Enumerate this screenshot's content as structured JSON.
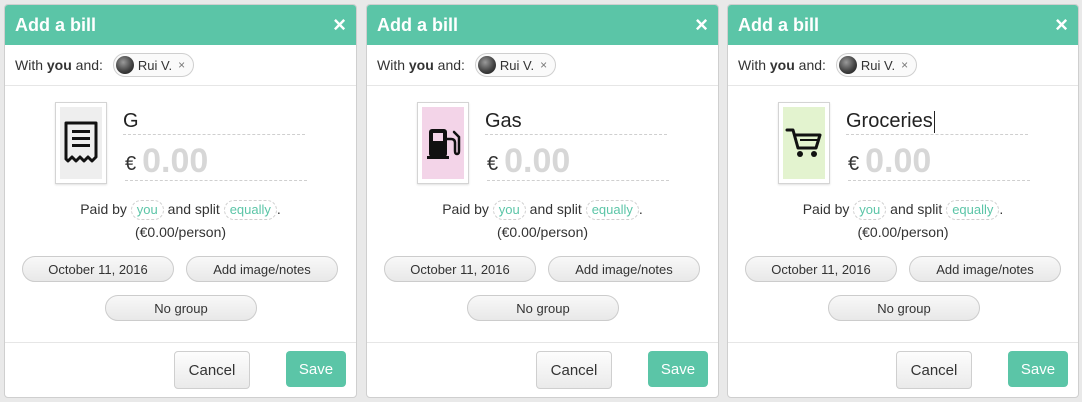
{
  "modals": [
    {
      "title": "Add a bill",
      "close_icon": "×",
      "with_prefix": "With",
      "with_you": "you",
      "with_suffix": "and:",
      "participant": "Rui V.",
      "participant_remove": "×",
      "category_icon": "receipt-icon",
      "category_bg": "#eeeeee",
      "description": "G",
      "currency": "€",
      "amount_placeholder": "0.00",
      "paid_by_label": "Paid by",
      "payer": "you",
      "split_label": "and split",
      "split_type": "equally",
      "period": ".",
      "per_person": "(€0.00/person)",
      "date": "October 11, 2016",
      "notes_button": "Add image/notes",
      "group_button": "No group",
      "cancel": "Cancel",
      "save": "Save"
    },
    {
      "title": "Add a bill",
      "close_icon": "×",
      "with_prefix": "With",
      "with_you": "you",
      "with_suffix": "and:",
      "participant": "Rui V.",
      "participant_remove": "×",
      "category_icon": "gas-pump-icon",
      "category_bg": "#f3d4e8",
      "description": "Gas",
      "currency": "€",
      "amount_placeholder": "0.00",
      "paid_by_label": "Paid by",
      "payer": "you",
      "split_label": "and split",
      "split_type": "equally",
      "period": ".",
      "per_person": "(€0.00/person)",
      "date": "October 11, 2016",
      "notes_button": "Add image/notes",
      "group_button": "No group",
      "cancel": "Cancel",
      "save": "Save"
    },
    {
      "title": "Add a bill",
      "close_icon": "×",
      "with_prefix": "With",
      "with_you": "you",
      "with_suffix": "and:",
      "participant": "Rui V.",
      "participant_remove": "×",
      "category_icon": "cart-icon",
      "category_bg": "#e3f3cf",
      "description": "Groceries",
      "currency": "€",
      "amount_placeholder": "0.00",
      "paid_by_label": "Paid by",
      "payer": "you",
      "split_label": "and split",
      "split_type": "equally",
      "period": ".",
      "per_person": "(€0.00/person)",
      "date": "October 11, 2016",
      "notes_button": "Add image/notes",
      "group_button": "No group",
      "cancel": "Cancel",
      "save": "Save"
    }
  ]
}
